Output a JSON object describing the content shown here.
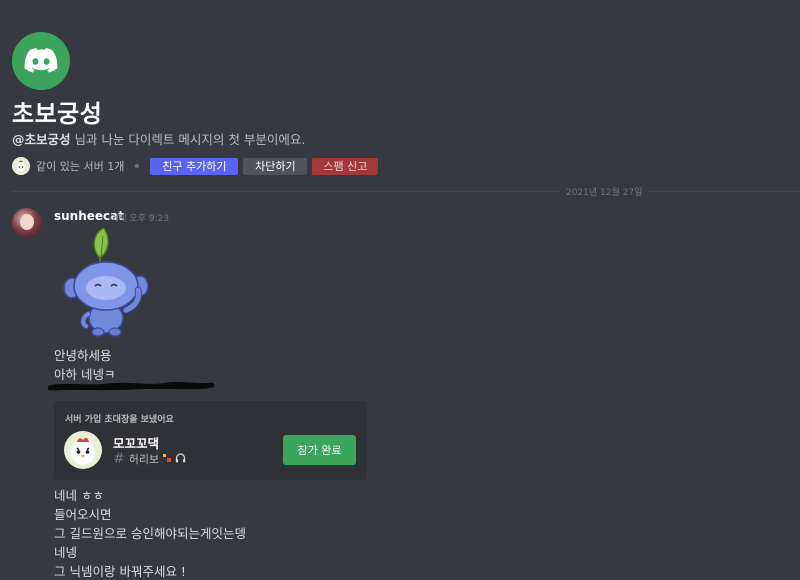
{
  "intro": {
    "title": "초보궁성",
    "subtitle_bold": "@초보궁성",
    "subtitle_rest": " 님과 나눈 다이렉트 메시지의 첫 부분이에요.",
    "mutual_servers": "같이 있는 서버 1개",
    "buttons": {
      "add_friend": "친구 추가하기",
      "block": "차단하기",
      "report_spam": "스팸 신고"
    }
  },
  "divider": {
    "date": "2021년 12월 27일"
  },
  "message": {
    "username": "sunheecat",
    "timestamp": "어제 오후 9:23",
    "lines_top": [
      "안녕하세용",
      "아하 네넹ㅋ"
    ],
    "invite": {
      "header": "서버 가입 초대장을 보냈어요",
      "server_name": "모꼬꼬댁",
      "channel": "허리보",
      "button": "참가 완료"
    },
    "lines_bottom": [
      "네네 ㅎㅎ",
      "들어오시면",
      "그 길드원으로 승인해야되는게잇는뎅",
      "네넹",
      "그 닉넴이랑 바꿔주세요 !"
    ]
  },
  "colors": {
    "background": "#36393f",
    "brand_green": "#3ba55c",
    "blurple": "#5865f2",
    "danger": "#a3383c"
  },
  "icons": [
    "discord-logo-icon",
    "mutual-server-icon",
    "chicken-server-icon",
    "hash-icon",
    "headphones-icon",
    "wumpus-sticker"
  ]
}
